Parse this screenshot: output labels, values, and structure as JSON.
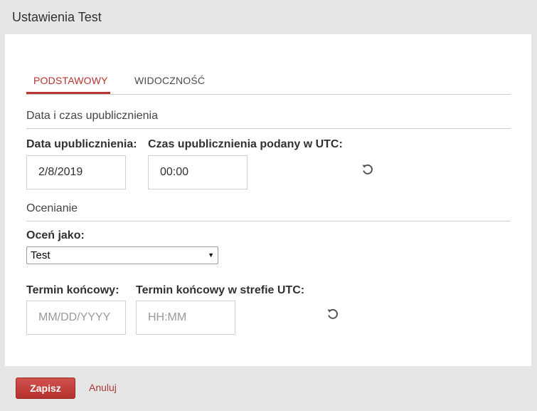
{
  "dialog": {
    "title": "Ustawienia Test"
  },
  "tabs": [
    {
      "label": "PODSTAWOWY",
      "active": true
    },
    {
      "label": "WIDOCZNOŚĆ",
      "active": false
    }
  ],
  "publish_section": {
    "heading": "Data i czas upublicznienia",
    "date_label": "Data upublicznienia:",
    "date_value": "2/8/2019",
    "time_label": "Czas upublicznienia podany w UTC:",
    "time_value": "00:00",
    "reset_icon": "reset-icon"
  },
  "grading_section": {
    "heading": "Ocenianie",
    "grade_as_label": "Oceń jako:",
    "grade_as_value": "Test",
    "due_date_label": "Termin końcowy:",
    "due_date_placeholder": "MM/DD/YYYY",
    "due_time_label": "Termin końcowy w strefie UTC:",
    "due_time_placeholder": "HH:MM",
    "reset_icon": "reset-icon"
  },
  "footer": {
    "save_label": "Zapisz",
    "cancel_label": "Anuluj"
  },
  "colors": {
    "accent": "#b9322f",
    "dialog_background": "#e6e6e6",
    "body_background": "#ffffff"
  }
}
